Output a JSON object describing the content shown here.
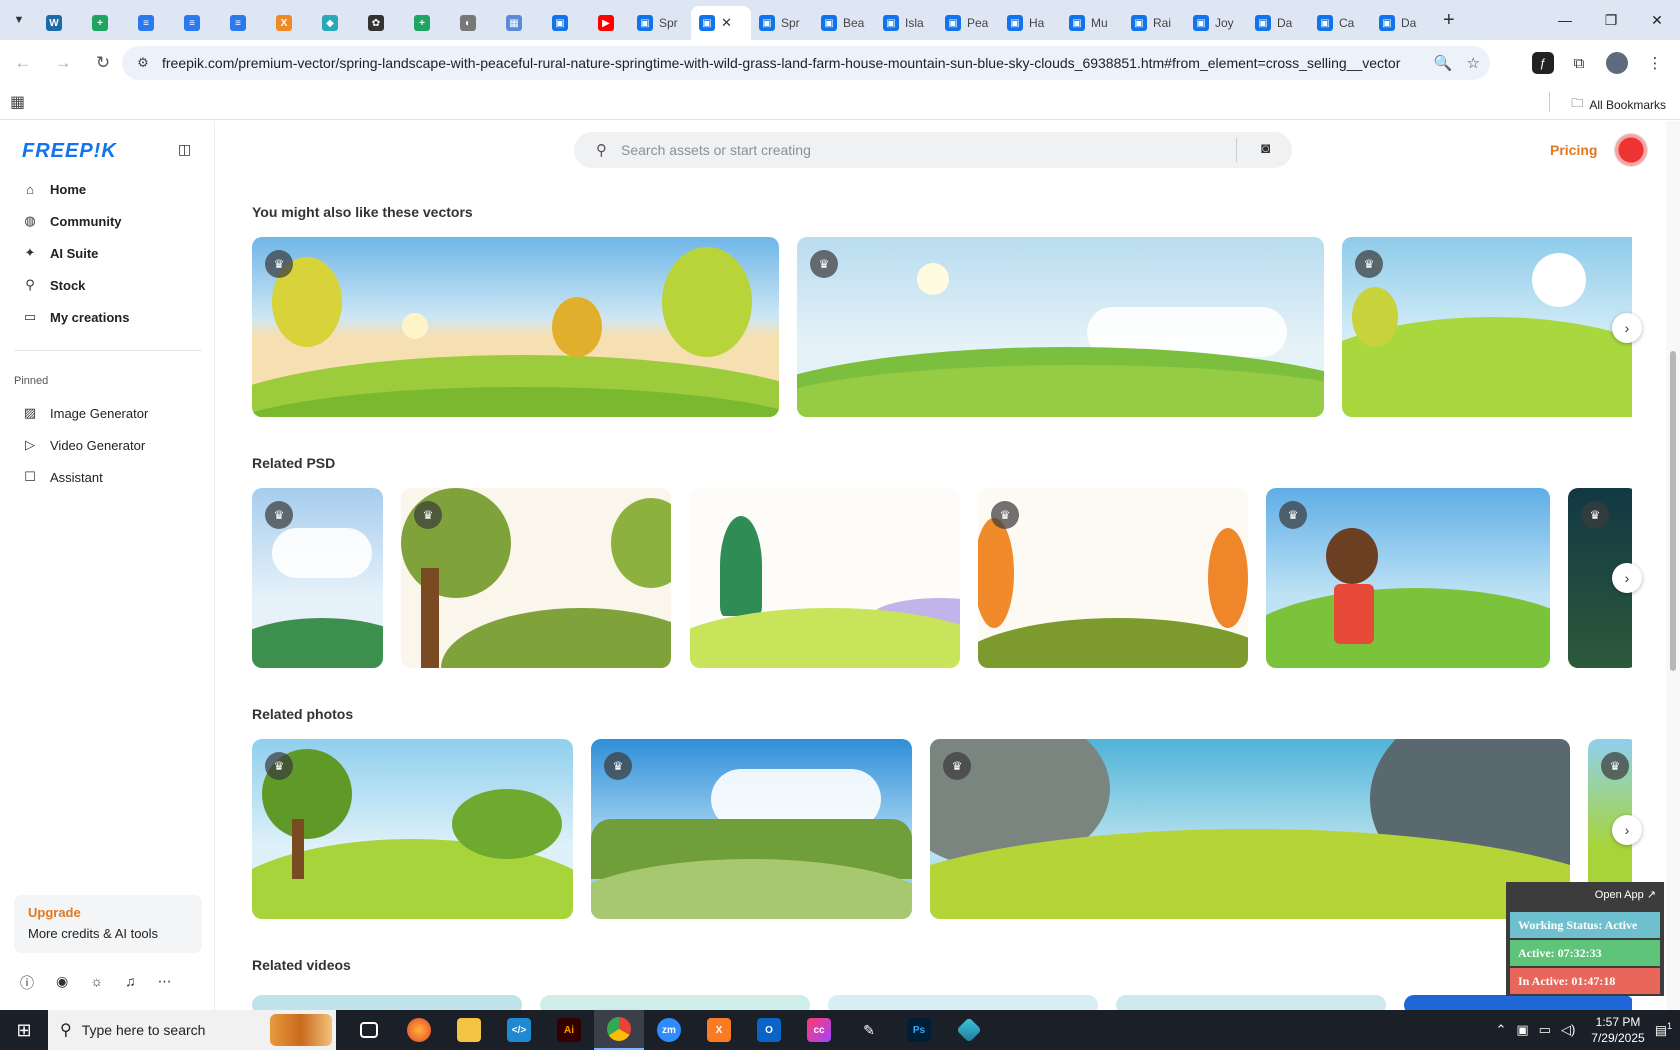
{
  "browser": {
    "tabs": [
      {
        "title": "",
        "icon": "wp-icon",
        "color": "#1e6aa8"
      },
      {
        "title": "",
        "icon": "sheets-icon",
        "color": "#1fa463"
      },
      {
        "title": "",
        "icon": "docs-icon",
        "color": "#2a79ee"
      },
      {
        "title": "",
        "icon": "docs-icon",
        "color": "#2a79ee"
      },
      {
        "title": "",
        "icon": "docs-icon",
        "color": "#2a79ee"
      },
      {
        "title": "",
        "icon": "xampp-icon",
        "color": "#f08a24"
      },
      {
        "title": "",
        "icon": "app-icon",
        "color": "#2aa8b8"
      },
      {
        "title": "",
        "icon": "openai-icon",
        "color": "#333333"
      },
      {
        "title": "",
        "icon": "sheets-icon",
        "color": "#1fa463"
      },
      {
        "title": "",
        "icon": "globe-icon",
        "color": "#777777"
      },
      {
        "title": "",
        "icon": "grid-icon",
        "color": "#5b8bd8"
      },
      {
        "title": "",
        "icon": "freepik-icon",
        "color": "#1273eb"
      },
      {
        "title": "",
        "icon": "youtube-icon",
        "color": "#ff0000"
      },
      {
        "title": "Spr",
        "icon": "freepik-icon",
        "color": "#1273eb"
      },
      {
        "title": "",
        "icon": "freepik-icon",
        "color": "#1273eb",
        "active": true
      },
      {
        "title": "Spr",
        "icon": "freepik-icon",
        "color": "#1273eb"
      },
      {
        "title": "Bea",
        "icon": "freepik-icon",
        "color": "#1273eb"
      },
      {
        "title": "Isla",
        "icon": "freepik-icon",
        "color": "#1273eb"
      },
      {
        "title": "Pea",
        "icon": "freepik-icon",
        "color": "#1273eb"
      },
      {
        "title": "Ha",
        "icon": "freepik-icon",
        "color": "#1273eb"
      },
      {
        "title": "Mu",
        "icon": "freepik-icon",
        "color": "#1273eb"
      },
      {
        "title": "Rai",
        "icon": "freepik-icon",
        "color": "#1273eb"
      },
      {
        "title": "Joy",
        "icon": "freepik-icon",
        "color": "#1273eb"
      },
      {
        "title": "Da",
        "icon": "freepik-icon",
        "color": "#1273eb"
      },
      {
        "title": "Ca",
        "icon": "freepik-icon",
        "color": "#1273eb"
      },
      {
        "title": "Da",
        "icon": "freepik-icon",
        "color": "#1273eb"
      }
    ],
    "url": "freepik.com/premium-vector/spring-landscape-with-peaceful-rural-nature-springtime-with-wild-grass-land-farm-house-mountain-sun-blue-sky-clouds_6938851.htm#from_element=cross_selling__vector",
    "bookmarks_label": "All Bookmarks"
  },
  "sidebar": {
    "logo": "FREEP!K",
    "nav": [
      {
        "label": "Home",
        "icon": "home-icon"
      },
      {
        "label": "Community",
        "icon": "globe-icon"
      },
      {
        "label": "AI Suite",
        "icon": "sparkle-icon"
      },
      {
        "label": "Stock",
        "icon": "search-icon"
      },
      {
        "label": "My creations",
        "icon": "folder-icon"
      }
    ],
    "pinned_label": "Pinned",
    "pinned": [
      {
        "label": "Image Generator",
        "icon": "image-icon"
      },
      {
        "label": "Video Generator",
        "icon": "video-icon"
      },
      {
        "label": "Assistant",
        "icon": "chat-icon"
      }
    ],
    "upgrade": {
      "title": "Upgrade",
      "subtitle": "More credits & AI tools"
    }
  },
  "header": {
    "search_placeholder": "Search assets or start creating",
    "pricing": "Pricing"
  },
  "sections": {
    "vectors": "You might also like these vectors",
    "psd": "Related PSD",
    "photos": "Related photos",
    "videos": "Related videos"
  },
  "widget": {
    "open_app": "Open App ↗",
    "status": "Working Status: Active",
    "active": "Active: 07:32:33",
    "inactive": "In Active: 01:47:18",
    "colors": {
      "status": "#6fc0cf",
      "active": "#5ec47a",
      "inactive": "#e8665a"
    }
  },
  "taskbar": {
    "search_text": "Type here to search",
    "time": "1:57 PM",
    "date": "7/29/2025",
    "notification_count": "1"
  }
}
